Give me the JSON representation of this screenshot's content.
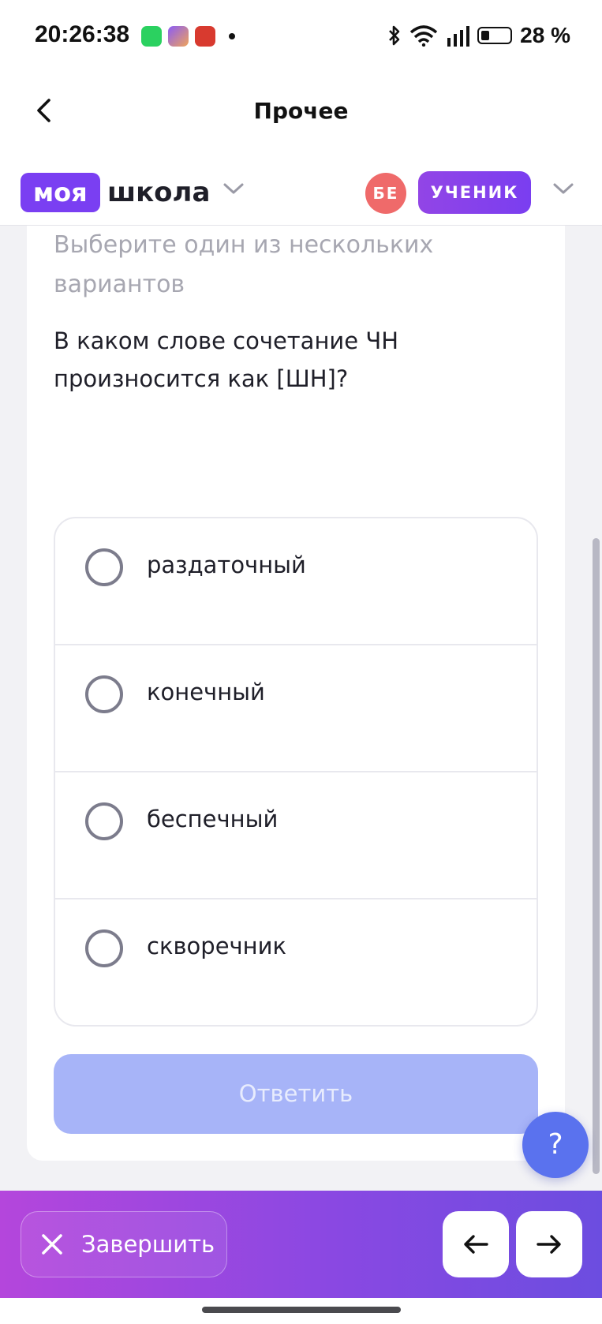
{
  "status": {
    "time": "20:26:38",
    "battery": "28 %",
    "apps": [
      "whatsapp-icon",
      "myschool-icon",
      "fire-icon"
    ]
  },
  "title_bar": {
    "title": "Прочее"
  },
  "header": {
    "logo_box": "моя",
    "logo_text": "школа",
    "avatar_initials": "БЕ",
    "role": "УЧЕНИК"
  },
  "task": {
    "instruction": "Выберите один из нескольких вариантов",
    "question": "В каком слове сочетание ЧН произносится как [ШН]?",
    "options": [
      {
        "label": "раздаточный"
      },
      {
        "label": "конечный"
      },
      {
        "label": "беспечный"
      },
      {
        "label": "скворечник"
      }
    ],
    "submit_label": "Ответить"
  },
  "help": {
    "label": "?"
  },
  "bottom": {
    "finish_label": "Завершить"
  },
  "colors": {
    "brand": "#7a3ff2",
    "submit_disabled": "#a7b4f8",
    "help": "#5a72ee",
    "avatar": "#ef6a6a"
  }
}
